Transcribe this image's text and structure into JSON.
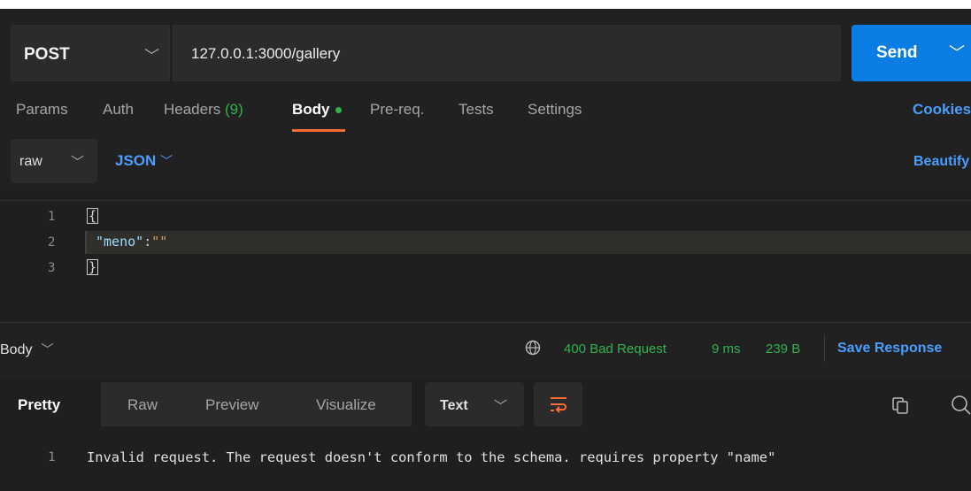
{
  "request": {
    "method": "POST",
    "url": "127.0.0.1:3000/gallery",
    "send_label": "Send"
  },
  "tabs": [
    {
      "label": "Params"
    },
    {
      "label": "Auth"
    },
    {
      "label": "Headers",
      "count": "(9)"
    },
    {
      "label": "Body",
      "active": true
    },
    {
      "label": "Pre-req."
    },
    {
      "label": "Tests"
    },
    {
      "label": "Settings"
    }
  ],
  "cookies_label": "Cookies",
  "body_options": {
    "mode": "raw",
    "format": "JSON",
    "beautify_label": "Beautify"
  },
  "editor": {
    "lines": [
      {
        "num": "1",
        "text": "{"
      },
      {
        "num": "2",
        "key": "\"meno\"",
        "colon": ":",
        "value": "\"\""
      },
      {
        "num": "3",
        "text": "}"
      }
    ]
  },
  "response": {
    "section_label": "Body",
    "status": "400 Bad Request",
    "time": "9 ms",
    "size": "239 B",
    "save_label": "Save Response",
    "view_tabs": [
      "Pretty",
      "Raw",
      "Preview",
      "Visualize"
    ],
    "active_view": "Pretty",
    "format": "Text",
    "output": [
      {
        "num": "1",
        "text": "Invalid request. The request doesn't conform to the schema. requires property \"name\""
      }
    ]
  },
  "colors": {
    "accent_orange": "#ff6c37",
    "link_blue": "#4a9eff",
    "send_blue": "#0a7de4",
    "status_green": "#2eb34d"
  },
  "icons": [
    "chevron-down-icon",
    "globe-icon",
    "wrap-lines-icon",
    "copy-icon",
    "search-icon"
  ]
}
